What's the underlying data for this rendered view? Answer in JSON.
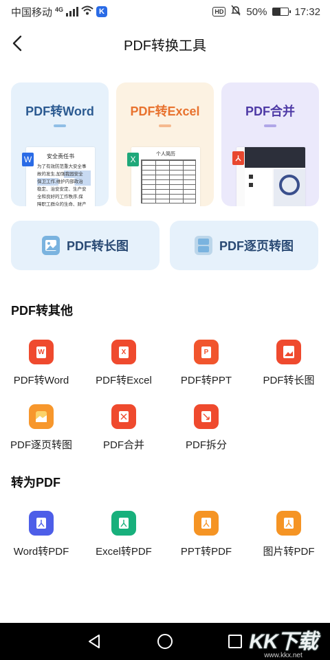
{
  "status": {
    "carrier": "中国移动",
    "network": "4G",
    "battery": "50%",
    "time": "17:32",
    "hd": "HD",
    "k_badge": "K"
  },
  "header": {
    "title": "PDF转换工具"
  },
  "cards": [
    {
      "title": "PDF转Word",
      "color": "#2b5a91",
      "doc_title": "安全责任书",
      "doc_lines": [
        "为了有效防范重大安全事",
        "故的发生,加强我园安全",
        "保卫工作,维护内部政治",
        "稳定、治安安定、生产安",
        "全和良好的工作秩序,保",
        "障职工群众的生命、财产"
      ],
      "badge": "W",
      "badge_color": "#2a6be6"
    },
    {
      "title": "PDF转Excel",
      "color": "#e8722e",
      "doc_title": "个人简历",
      "badge": "X",
      "badge_color": "#1fa87a"
    },
    {
      "title": "PDF合并",
      "color": "#4e3aa6",
      "badge_color": "#e8472f"
    }
  ],
  "wide_buttons": [
    {
      "label": "PDF转长图"
    },
    {
      "label": "PDF逐页转图"
    }
  ],
  "section_other": {
    "title": "PDF转其他",
    "items": [
      {
        "label": "PDF转Word",
        "icon": "W",
        "color": "#ef4a2e"
      },
      {
        "label": "PDF转Excel",
        "icon": "X",
        "color": "#ef4a2e"
      },
      {
        "label": "PDF转PPT",
        "icon": "P",
        "color": "#f1552d"
      },
      {
        "label": "PDF转长图",
        "icon": "image",
        "color": "#ef4a2e"
      },
      {
        "label": "PDF逐页转图",
        "icon": "image",
        "color": "#f7972c"
      },
      {
        "label": "PDF合并",
        "icon": "merge",
        "color": "#ef4a2e"
      },
      {
        "label": "PDF拆分",
        "icon": "split",
        "color": "#ef4a2e"
      }
    ]
  },
  "section_to_pdf": {
    "title": "转为PDF",
    "items": [
      {
        "label": "Word转PDF",
        "color": "#4d5ee8"
      },
      {
        "label": "Excel转PDF",
        "color": "#18b07c"
      },
      {
        "label": "PPT转PDF",
        "color": "#f59424"
      },
      {
        "label": "图片转PDF",
        "color": "#f59424"
      }
    ]
  },
  "watermark": {
    "big": "KK下载",
    "small": "www.kkx.net"
  }
}
